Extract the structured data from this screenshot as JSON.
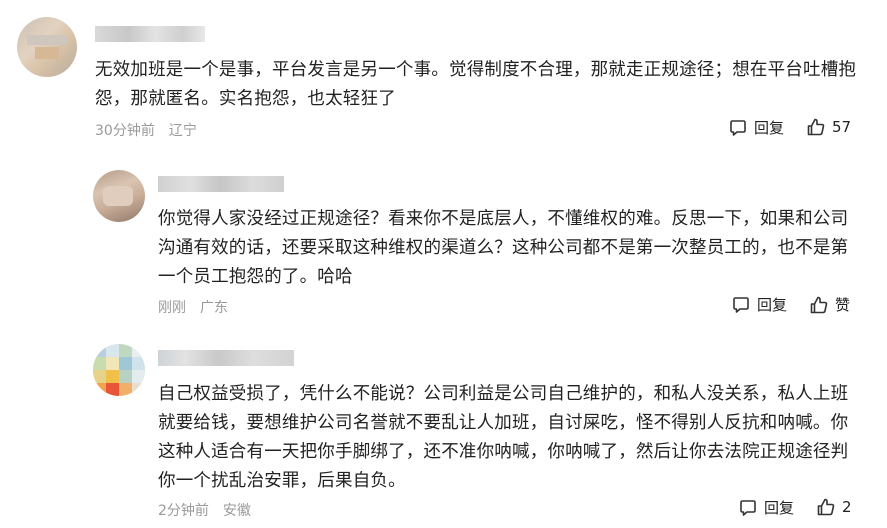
{
  "comments": [
    {
      "text": "无效加班是一个是事，平台发言是另一个事。觉得制度不合理，那就走正规途径；想在平台吐槽抱怨，那就匿名。实名抱怨，也太轻狂了",
      "time": "30分钟前",
      "location": "辽宁",
      "reply_label": "回复",
      "like_label": "57"
    },
    {
      "text": "你觉得人家没经过正规途径？看来你不是底层人，不懂维权的难。反思一下，如果和公司沟通有效的话，还要采取这种维权的渠道么？这种公司都不是第一次整员工的，也不是第一个员工抱怨的了。哈哈",
      "time": "刚刚",
      "location": "广东",
      "reply_label": "回复",
      "like_label": "赞"
    },
    {
      "text": "自己权益受损了，凭什么不能说？公司利益是公司自己维护的，和私人没关系，私人上班就要给钱，要想维护公司名誉就不要乱让人加班，自讨屎吃，怪不得别人反抗和呐喊。你这种人适合有一天把你手脚绑了，还不准你呐喊，你呐喊了，然后让你去法院正规途径判你一个扰乱治安罪，后果自负。",
      "time": "2分钟前",
      "location": "安徽",
      "reply_label": "回复",
      "like_label": "2"
    }
  ],
  "icons": {
    "comment": "comment-bubble-icon",
    "like": "thumbs-up-icon"
  },
  "colors": {
    "text": "#222222",
    "meta": "#9a9a9a",
    "background": "#ffffff"
  }
}
